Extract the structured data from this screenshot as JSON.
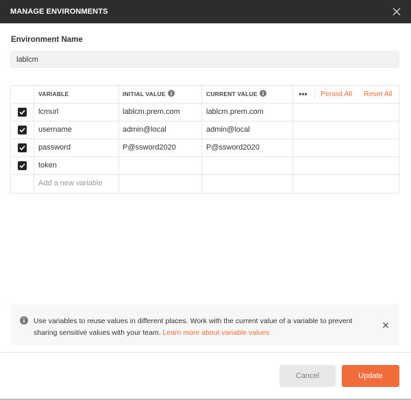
{
  "dialog": {
    "title": "MANAGE ENVIRONMENTS"
  },
  "environment": {
    "label": "Environment Name",
    "value": "lablcm"
  },
  "table": {
    "headers": {
      "variable": "VARIABLE",
      "initial_value": "INITIAL VALUE",
      "current_value": "CURRENT VALUE"
    },
    "actions": {
      "more": "•••",
      "persist_all": "Persist All",
      "reset_all": "Reset All"
    },
    "rows": [
      {
        "checked": true,
        "variable": "lcmurl",
        "initial_value": "lablcm.prem.com",
        "current_value": "lablcm.prem.com"
      },
      {
        "checked": true,
        "variable": "username",
        "initial_value": "admin@local",
        "current_value": "admin@local"
      },
      {
        "checked": true,
        "variable": "password",
        "initial_value": "P@ssword2020",
        "current_value": "P@ssword2020"
      },
      {
        "checked": true,
        "variable": "token",
        "initial_value": "",
        "current_value": ""
      }
    ],
    "new_row_placeholder": "Add a new variable"
  },
  "banner": {
    "text": "Use variables to reuse values in different places. Work with the current value of a variable to prevent sharing sensitive values with your team.",
    "link": "Learn more about variable values"
  },
  "footer": {
    "cancel_label": "Cancel",
    "update_label": "Update"
  },
  "colors": {
    "accent": "#f26b3a",
    "titlebar": "#2d2d2d"
  }
}
